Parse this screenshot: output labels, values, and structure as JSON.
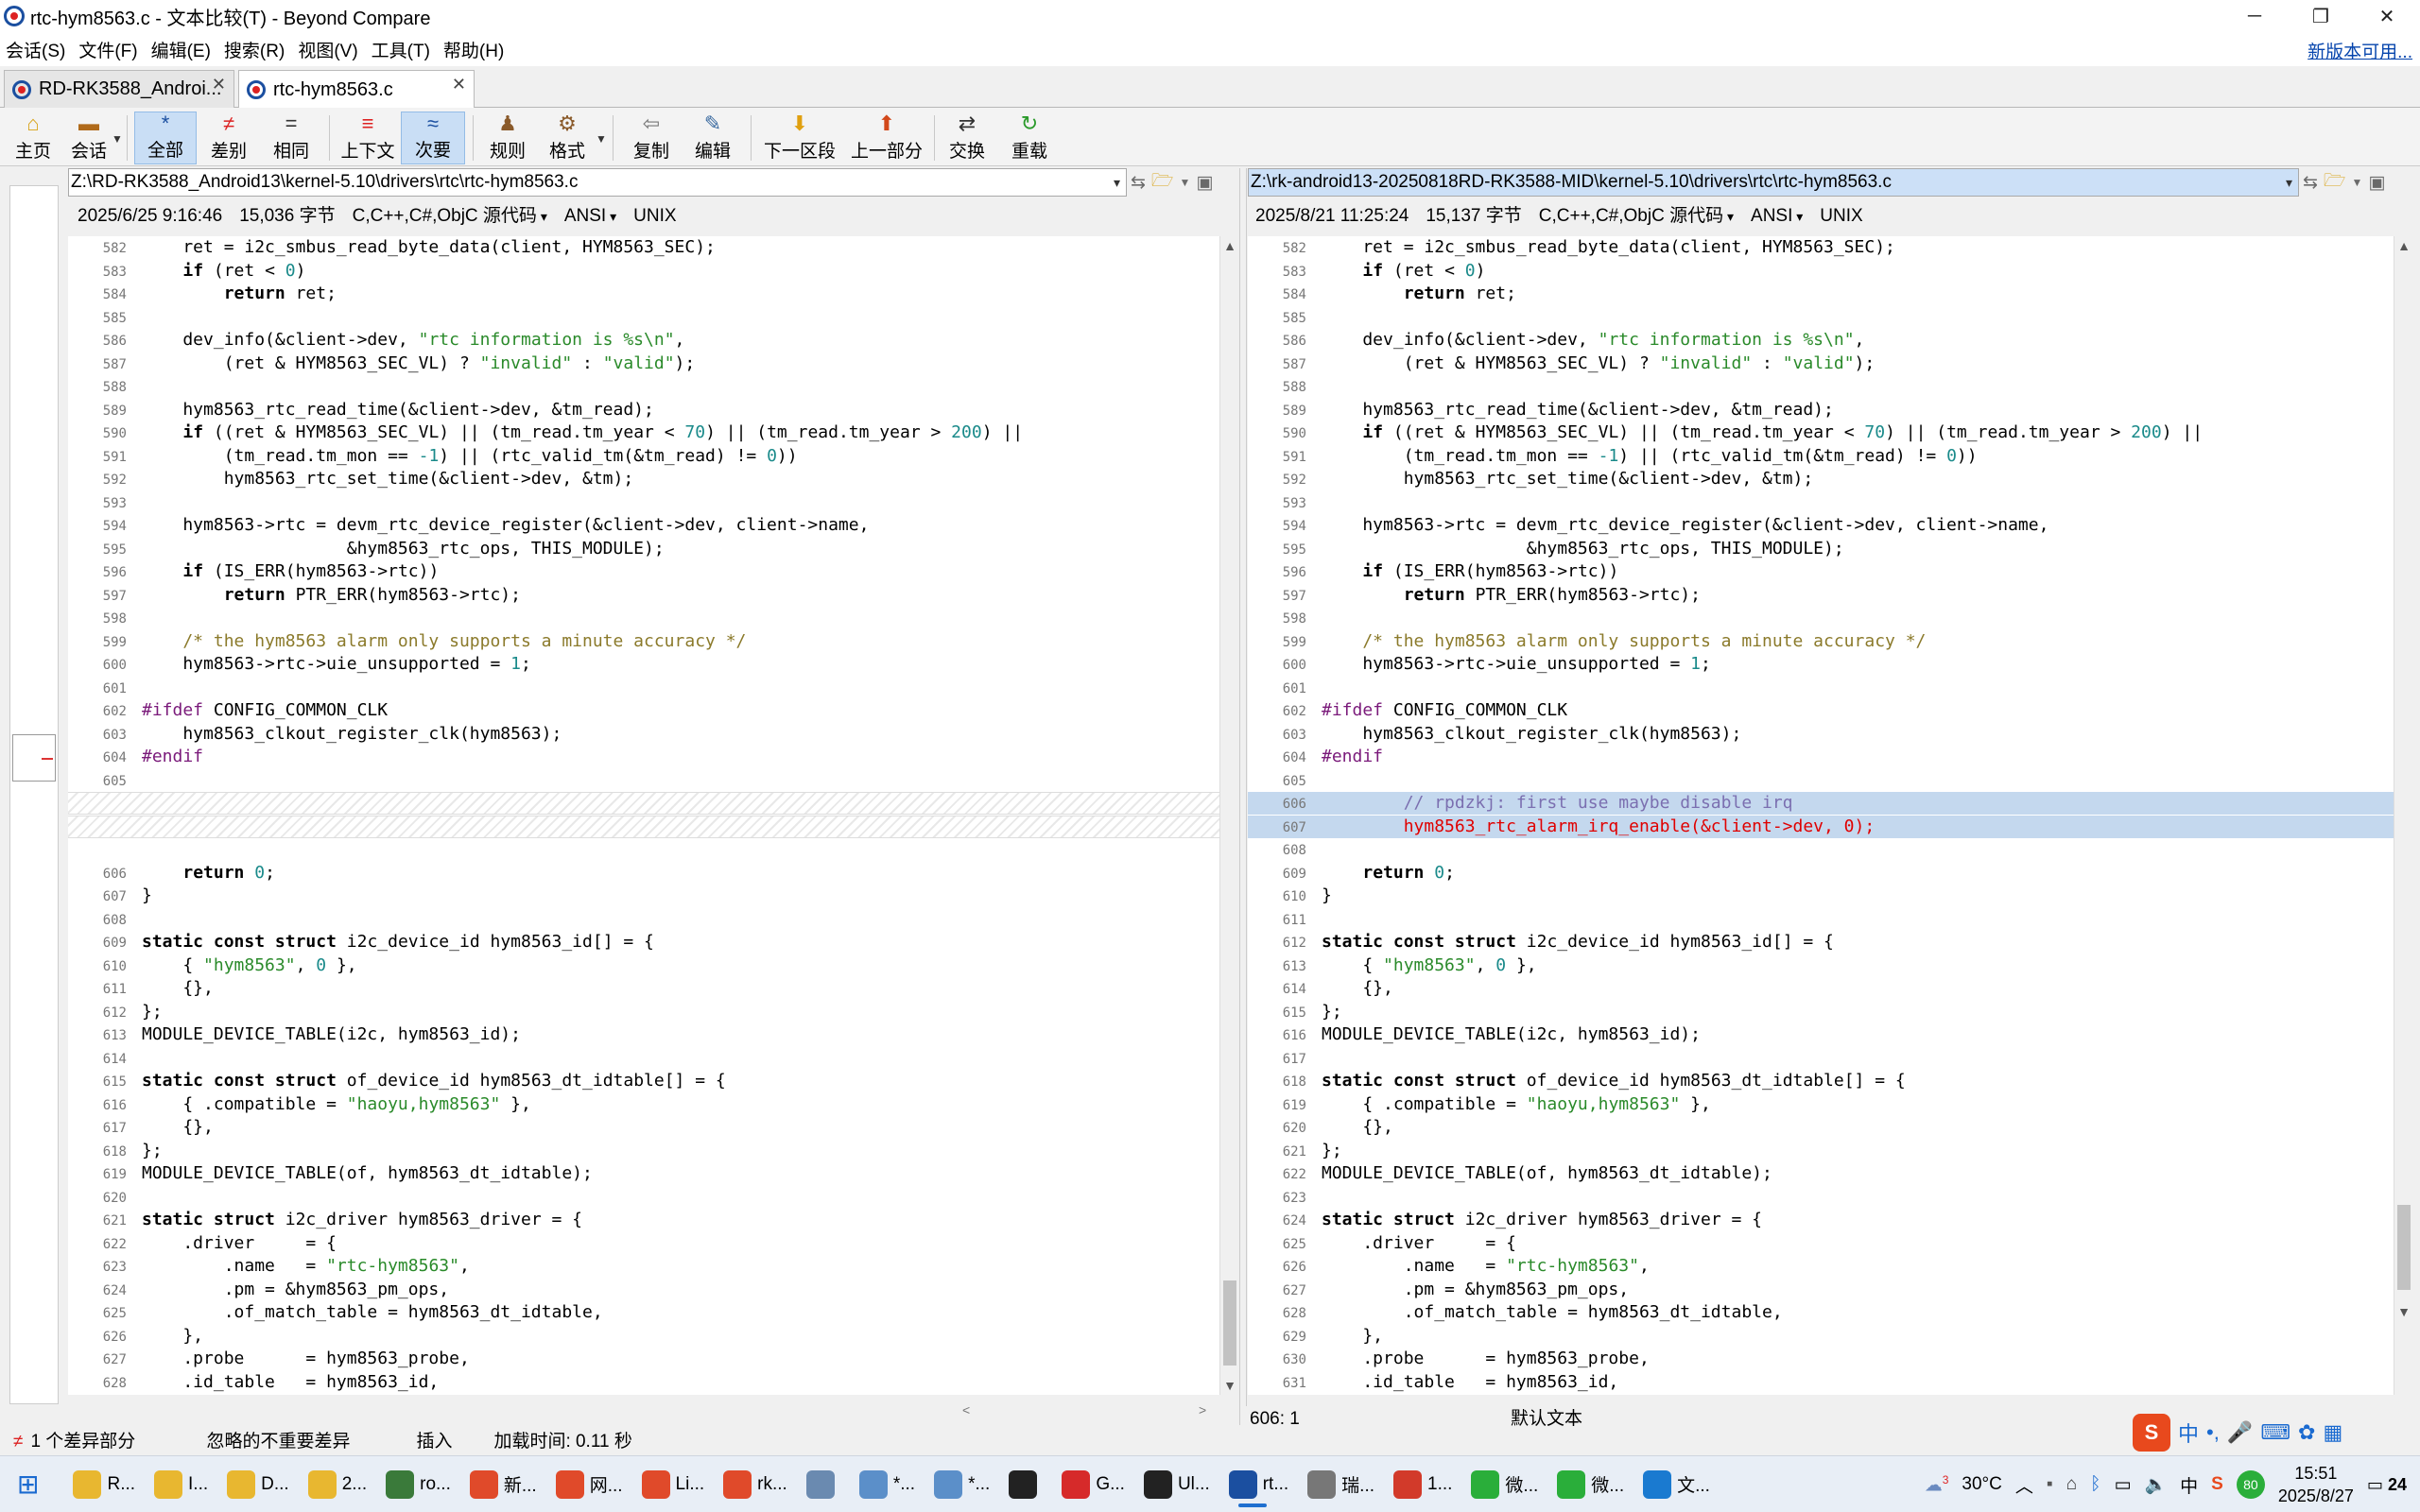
{
  "window": {
    "title": "rtc-hym8563.c - 文本比较(T) - Beyond Compare",
    "minimize": "─",
    "restore": "❐",
    "close": "✕"
  },
  "menu": {
    "items": [
      "会话(S)",
      "文件(F)",
      "编辑(E)",
      "搜索(R)",
      "视图(V)",
      "工具(T)",
      "帮助(H)"
    ],
    "update_link": "新版本可用..."
  },
  "tabs": [
    {
      "label": "RD-RK3588_Androi...",
      "close": "✕"
    },
    {
      "label": "rtc-hym8563.c",
      "close": "✕"
    }
  ],
  "toolbar": {
    "buttons": [
      {
        "label": "主页",
        "icon": "home-icon"
      },
      {
        "label": "会话",
        "icon": "session-icon"
      },
      {
        "label": "全部",
        "icon": "star-icon"
      },
      {
        "label": "差别",
        "icon": "not-equal-icon"
      },
      {
        "label": "相同",
        "icon": "equal-icon"
      },
      {
        "label": "上下文",
        "icon": "context-icon"
      },
      {
        "label": "次要",
        "icon": "approx-icon"
      },
      {
        "label": "规则",
        "icon": "rules-icon"
      },
      {
        "label": "格式",
        "icon": "format-icon"
      },
      {
        "label": "复制",
        "icon": "copy-icon"
      },
      {
        "label": "编辑",
        "icon": "edit-icon"
      },
      {
        "label": "下一区段",
        "icon": "next-section-icon"
      },
      {
        "label": "上一部分",
        "icon": "prev-section-icon"
      },
      {
        "label": "交换",
        "icon": "swap-icon"
      },
      {
        "label": "重载",
        "icon": "reload-icon"
      }
    ]
  },
  "left": {
    "path": "Z:\\RD-RK3588_Android13\\kernel-5.10\\drivers\\rtc\\rtc-hym8563.c",
    "date": "2025/6/25 9:16:46",
    "size": "15,036 字节",
    "format": "C,C++,C#,ObjC 源代码",
    "encoding": "ANSI",
    "eol": "UNIX",
    "status_position": "",
    "lines": [
      {
        "n": "582",
        "t": "    ret = i2c_smbus_read_byte_data(client, HYM8563_SEC);"
      },
      {
        "n": "583",
        "t": "    if (ret < 0)"
      },
      {
        "n": "584",
        "t": "        return ret;"
      },
      {
        "n": "585",
        "t": ""
      },
      {
        "n": "586",
        "t": "    dev_info(&client->dev, \"rtc information is %s\\n\","
      },
      {
        "n": "587",
        "t": "        (ret & HYM8563_SEC_VL) ? \"invalid\" : \"valid\");"
      },
      {
        "n": "588",
        "t": ""
      },
      {
        "n": "589",
        "t": "    hym8563_rtc_read_time(&client->dev, &tm_read);"
      },
      {
        "n": "590",
        "t": "    if ((ret & HYM8563_SEC_VL) || (tm_read.tm_year < 70) || (tm_read.tm_year > 200) ||"
      },
      {
        "n": "591",
        "t": "        (tm_read.tm_mon == -1) || (rtc_valid_tm(&tm_read) != 0))"
      },
      {
        "n": "592",
        "t": "        hym8563_rtc_set_time(&client->dev, &tm);"
      },
      {
        "n": "593",
        "t": ""
      },
      {
        "n": "594",
        "t": "    hym8563->rtc = devm_rtc_device_register(&client->dev, client->name,"
      },
      {
        "n": "595",
        "t": "                    &hym8563_rtc_ops, THIS_MODULE);"
      },
      {
        "n": "596",
        "t": "    if (IS_ERR(hym8563->rtc))"
      },
      {
        "n": "597",
        "t": "        return PTR_ERR(hym8563->rtc);"
      },
      {
        "n": "598",
        "t": ""
      },
      {
        "n": "599",
        "t": "    /* the hym8563 alarm only supports a minute accuracy */"
      },
      {
        "n": "600",
        "t": "    hym8563->rtc->uie_unsupported = 1;"
      },
      {
        "n": "601",
        "t": ""
      },
      {
        "n": "602",
        "t": "#ifdef CONFIG_COMMON_CLK"
      },
      {
        "n": "603",
        "t": "    hym8563_clkout_register_clk(hym8563);"
      },
      {
        "n": "604",
        "t": "#endif"
      },
      {
        "n": "605",
        "t": ""
      },
      {
        "n": "",
        "t": "",
        "filler": true
      },
      {
        "n": "",
        "t": "",
        "filler": true
      },
      {
        "n": "",
        "t": ""
      },
      {
        "n": "606",
        "t": "    return 0;"
      },
      {
        "n": "607",
        "t": "}"
      },
      {
        "n": "608",
        "t": ""
      },
      {
        "n": "609",
        "t": "static const struct i2c_device_id hym8563_id[] = {"
      },
      {
        "n": "610",
        "t": "    { \"hym8563\", 0 },"
      },
      {
        "n": "611",
        "t": "    {},"
      },
      {
        "n": "612",
        "t": "};"
      },
      {
        "n": "613",
        "t": "MODULE_DEVICE_TABLE(i2c, hym8563_id);"
      },
      {
        "n": "614",
        "t": ""
      },
      {
        "n": "615",
        "t": "static const struct of_device_id hym8563_dt_idtable[] = {"
      },
      {
        "n": "616",
        "t": "    { .compatible = \"haoyu,hym8563\" },"
      },
      {
        "n": "617",
        "t": "    {},"
      },
      {
        "n": "618",
        "t": "};"
      },
      {
        "n": "619",
        "t": "MODULE_DEVICE_TABLE(of, hym8563_dt_idtable);"
      },
      {
        "n": "620",
        "t": ""
      },
      {
        "n": "621",
        "t": "static struct i2c_driver hym8563_driver = {"
      },
      {
        "n": "622",
        "t": "    .driver     = {"
      },
      {
        "n": "623",
        "t": "        .name   = \"rtc-hym8563\","
      },
      {
        "n": "624",
        "t": "        .pm = &hym8563_pm_ops,"
      },
      {
        "n": "625",
        "t": "        .of_match_table = hym8563_dt_idtable,"
      },
      {
        "n": "626",
        "t": "    },"
      },
      {
        "n": "627",
        "t": "    .probe      = hym8563_probe,"
      },
      {
        "n": "628",
        "t": "    .id_table   = hym8563_id,"
      },
      {
        "n": "629",
        "t": "};"
      }
    ]
  },
  "right": {
    "path": "Z:\\rk-android13-20250818RD-RK3588-MID\\kernel-5.10\\drivers\\rtc\\rtc-hym8563.c",
    "date": "2025/8/21 11:25:24",
    "size": "15,137 字节",
    "format": "C,C++,C#,ObjC 源代码",
    "encoding": "ANSI",
    "eol": "UNIX",
    "lines": [
      {
        "n": "582",
        "t": "    ret = i2c_smbus_read_byte_data(client, HYM8563_SEC);"
      },
      {
        "n": "583",
        "t": "    if (ret < 0)"
      },
      {
        "n": "584",
        "t": "        return ret;"
      },
      {
        "n": "585",
        "t": ""
      },
      {
        "n": "586",
        "t": "    dev_info(&client->dev, \"rtc information is %s\\n\","
      },
      {
        "n": "587",
        "t": "        (ret & HYM8563_SEC_VL) ? \"invalid\" : \"valid\");"
      },
      {
        "n": "588",
        "t": ""
      },
      {
        "n": "589",
        "t": "    hym8563_rtc_read_time(&client->dev, &tm_read);"
      },
      {
        "n": "590",
        "t": "    if ((ret & HYM8563_SEC_VL) || (tm_read.tm_year < 70) || (tm_read.tm_year > 200) ||"
      },
      {
        "n": "591",
        "t": "        (tm_read.tm_mon == -1) || (rtc_valid_tm(&tm_read) != 0))"
      },
      {
        "n": "592",
        "t": "        hym8563_rtc_set_time(&client->dev, &tm);"
      },
      {
        "n": "593",
        "t": ""
      },
      {
        "n": "594",
        "t": "    hym8563->rtc = devm_rtc_device_register(&client->dev, client->name,"
      },
      {
        "n": "595",
        "t": "                    &hym8563_rtc_ops, THIS_MODULE);"
      },
      {
        "n": "596",
        "t": "    if (IS_ERR(hym8563->rtc))"
      },
      {
        "n": "597",
        "t": "        return PTR_ERR(hym8563->rtc);"
      },
      {
        "n": "598",
        "t": ""
      },
      {
        "n": "599",
        "t": "    /* the hym8563 alarm only supports a minute accuracy */"
      },
      {
        "n": "600",
        "t": "    hym8563->rtc->uie_unsupported = 1;"
      },
      {
        "n": "601",
        "t": ""
      },
      {
        "n": "602",
        "t": "#ifdef CONFIG_COMMON_CLK"
      },
      {
        "n": "603",
        "t": "    hym8563_clkout_register_clk(hym8563);"
      },
      {
        "n": "604",
        "t": "#endif"
      },
      {
        "n": "605",
        "t": ""
      },
      {
        "n": "606",
        "t": "        // rpdzkj: first use maybe disable irq",
        "diff": true,
        "comment": true
      },
      {
        "n": "607",
        "t": "        hym8563_rtc_alarm_irq_enable(&client->dev, 0);",
        "diff": true
      },
      {
        "n": "608",
        "t": ""
      },
      {
        "n": "609",
        "t": "    return 0;"
      },
      {
        "n": "610",
        "t": "}"
      },
      {
        "n": "611",
        "t": ""
      },
      {
        "n": "612",
        "t": "static const struct i2c_device_id hym8563_id[] = {"
      },
      {
        "n": "613",
        "t": "    { \"hym8563\", 0 },"
      },
      {
        "n": "614",
        "t": "    {},"
      },
      {
        "n": "615",
        "t": "};"
      },
      {
        "n": "616",
        "t": "MODULE_DEVICE_TABLE(i2c, hym8563_id);"
      },
      {
        "n": "617",
        "t": ""
      },
      {
        "n": "618",
        "t": "static const struct of_device_id hym8563_dt_idtable[] = {"
      },
      {
        "n": "619",
        "t": "    { .compatible = \"haoyu,hym8563\" },"
      },
      {
        "n": "620",
        "t": "    {},"
      },
      {
        "n": "621",
        "t": "};"
      },
      {
        "n": "622",
        "t": "MODULE_DEVICE_TABLE(of, hym8563_dt_idtable);"
      },
      {
        "n": "623",
        "t": ""
      },
      {
        "n": "624",
        "t": "static struct i2c_driver hym8563_driver = {"
      },
      {
        "n": "625",
        "t": "    .driver     = {"
      },
      {
        "n": "626",
        "t": "        .name   = \"rtc-hym8563\","
      },
      {
        "n": "627",
        "t": "        .pm = &hym8563_pm_ops,"
      },
      {
        "n": "628",
        "t": "        .of_match_table = hym8563_dt_idtable,"
      },
      {
        "n": "629",
        "t": "    },"
      },
      {
        "n": "630",
        "t": "    .probe      = hym8563_probe,"
      },
      {
        "n": "631",
        "t": "    .id_table   = hym8563_id,"
      },
      {
        "n": "632",
        "t": "};"
      }
    ]
  },
  "status": {
    "diff_count": "1 个差异部分",
    "ignored": "忽略的不重要差异",
    "mode": "插入",
    "load_time": "加载时间: 0.11 秒",
    "cursor": "606: 1",
    "text_type": "默认文本"
  },
  "taskbar": {
    "items": [
      {
        "label": "R...",
        "icon": "folder-icon",
        "color": "#e8b730"
      },
      {
        "label": "I...",
        "icon": "folder-icon",
        "color": "#e8b730"
      },
      {
        "label": "D...",
        "icon": "folder-icon",
        "color": "#e8b730"
      },
      {
        "label": "2...",
        "icon": "folder-icon",
        "color": "#e8b730"
      },
      {
        "label": "ro...",
        "icon": "app-icon",
        "color": "#3a7a3a"
      },
      {
        "label": "新...",
        "icon": "browser-icon",
        "color": "#e04a2a"
      },
      {
        "label": "网...",
        "icon": "browser-icon",
        "color": "#e04a2a"
      },
      {
        "label": "Li...",
        "icon": "browser-icon",
        "color": "#e04a2a"
      },
      {
        "label": "rk...",
        "icon": "browser-icon",
        "color": "#e04a2a"
      },
      {
        "label": "",
        "icon": "tool-icon",
        "color": "#6a8ab0"
      },
      {
        "label": "*...",
        "icon": "editor-icon",
        "color": "#5b8fc9"
      },
      {
        "label": "*...",
        "icon": "editor-icon",
        "color": "#5b8fc9"
      },
      {
        "label": "",
        "icon": "terminal-icon",
        "color": "#222222"
      },
      {
        "label": "G...",
        "icon": "wps-icon",
        "color": "#d62a2a"
      },
      {
        "label": "Ul...",
        "icon": "ue-icon",
        "color": "#222222"
      },
      {
        "label": "rt...",
        "icon": "bc-icon",
        "color": "#1b4fa0"
      },
      {
        "label": "瑞...",
        "icon": "tool-icon",
        "color": "#777777"
      },
      {
        "label": "1...",
        "icon": "app-icon",
        "color": "#d23a2a"
      },
      {
        "label": "微...",
        "icon": "wechat-icon",
        "color": "#2aae3a"
      },
      {
        "label": "微...",
        "icon": "wechat-icon",
        "color": "#2aae3a"
      },
      {
        "label": "文...",
        "icon": "app-icon",
        "color": "#1a7ad0"
      }
    ],
    "weather_badge": "3",
    "temperature": "30°C",
    "time": "15:51",
    "date": "2025/8/27",
    "notifications": "24",
    "battery": "80",
    "ime": "中"
  }
}
